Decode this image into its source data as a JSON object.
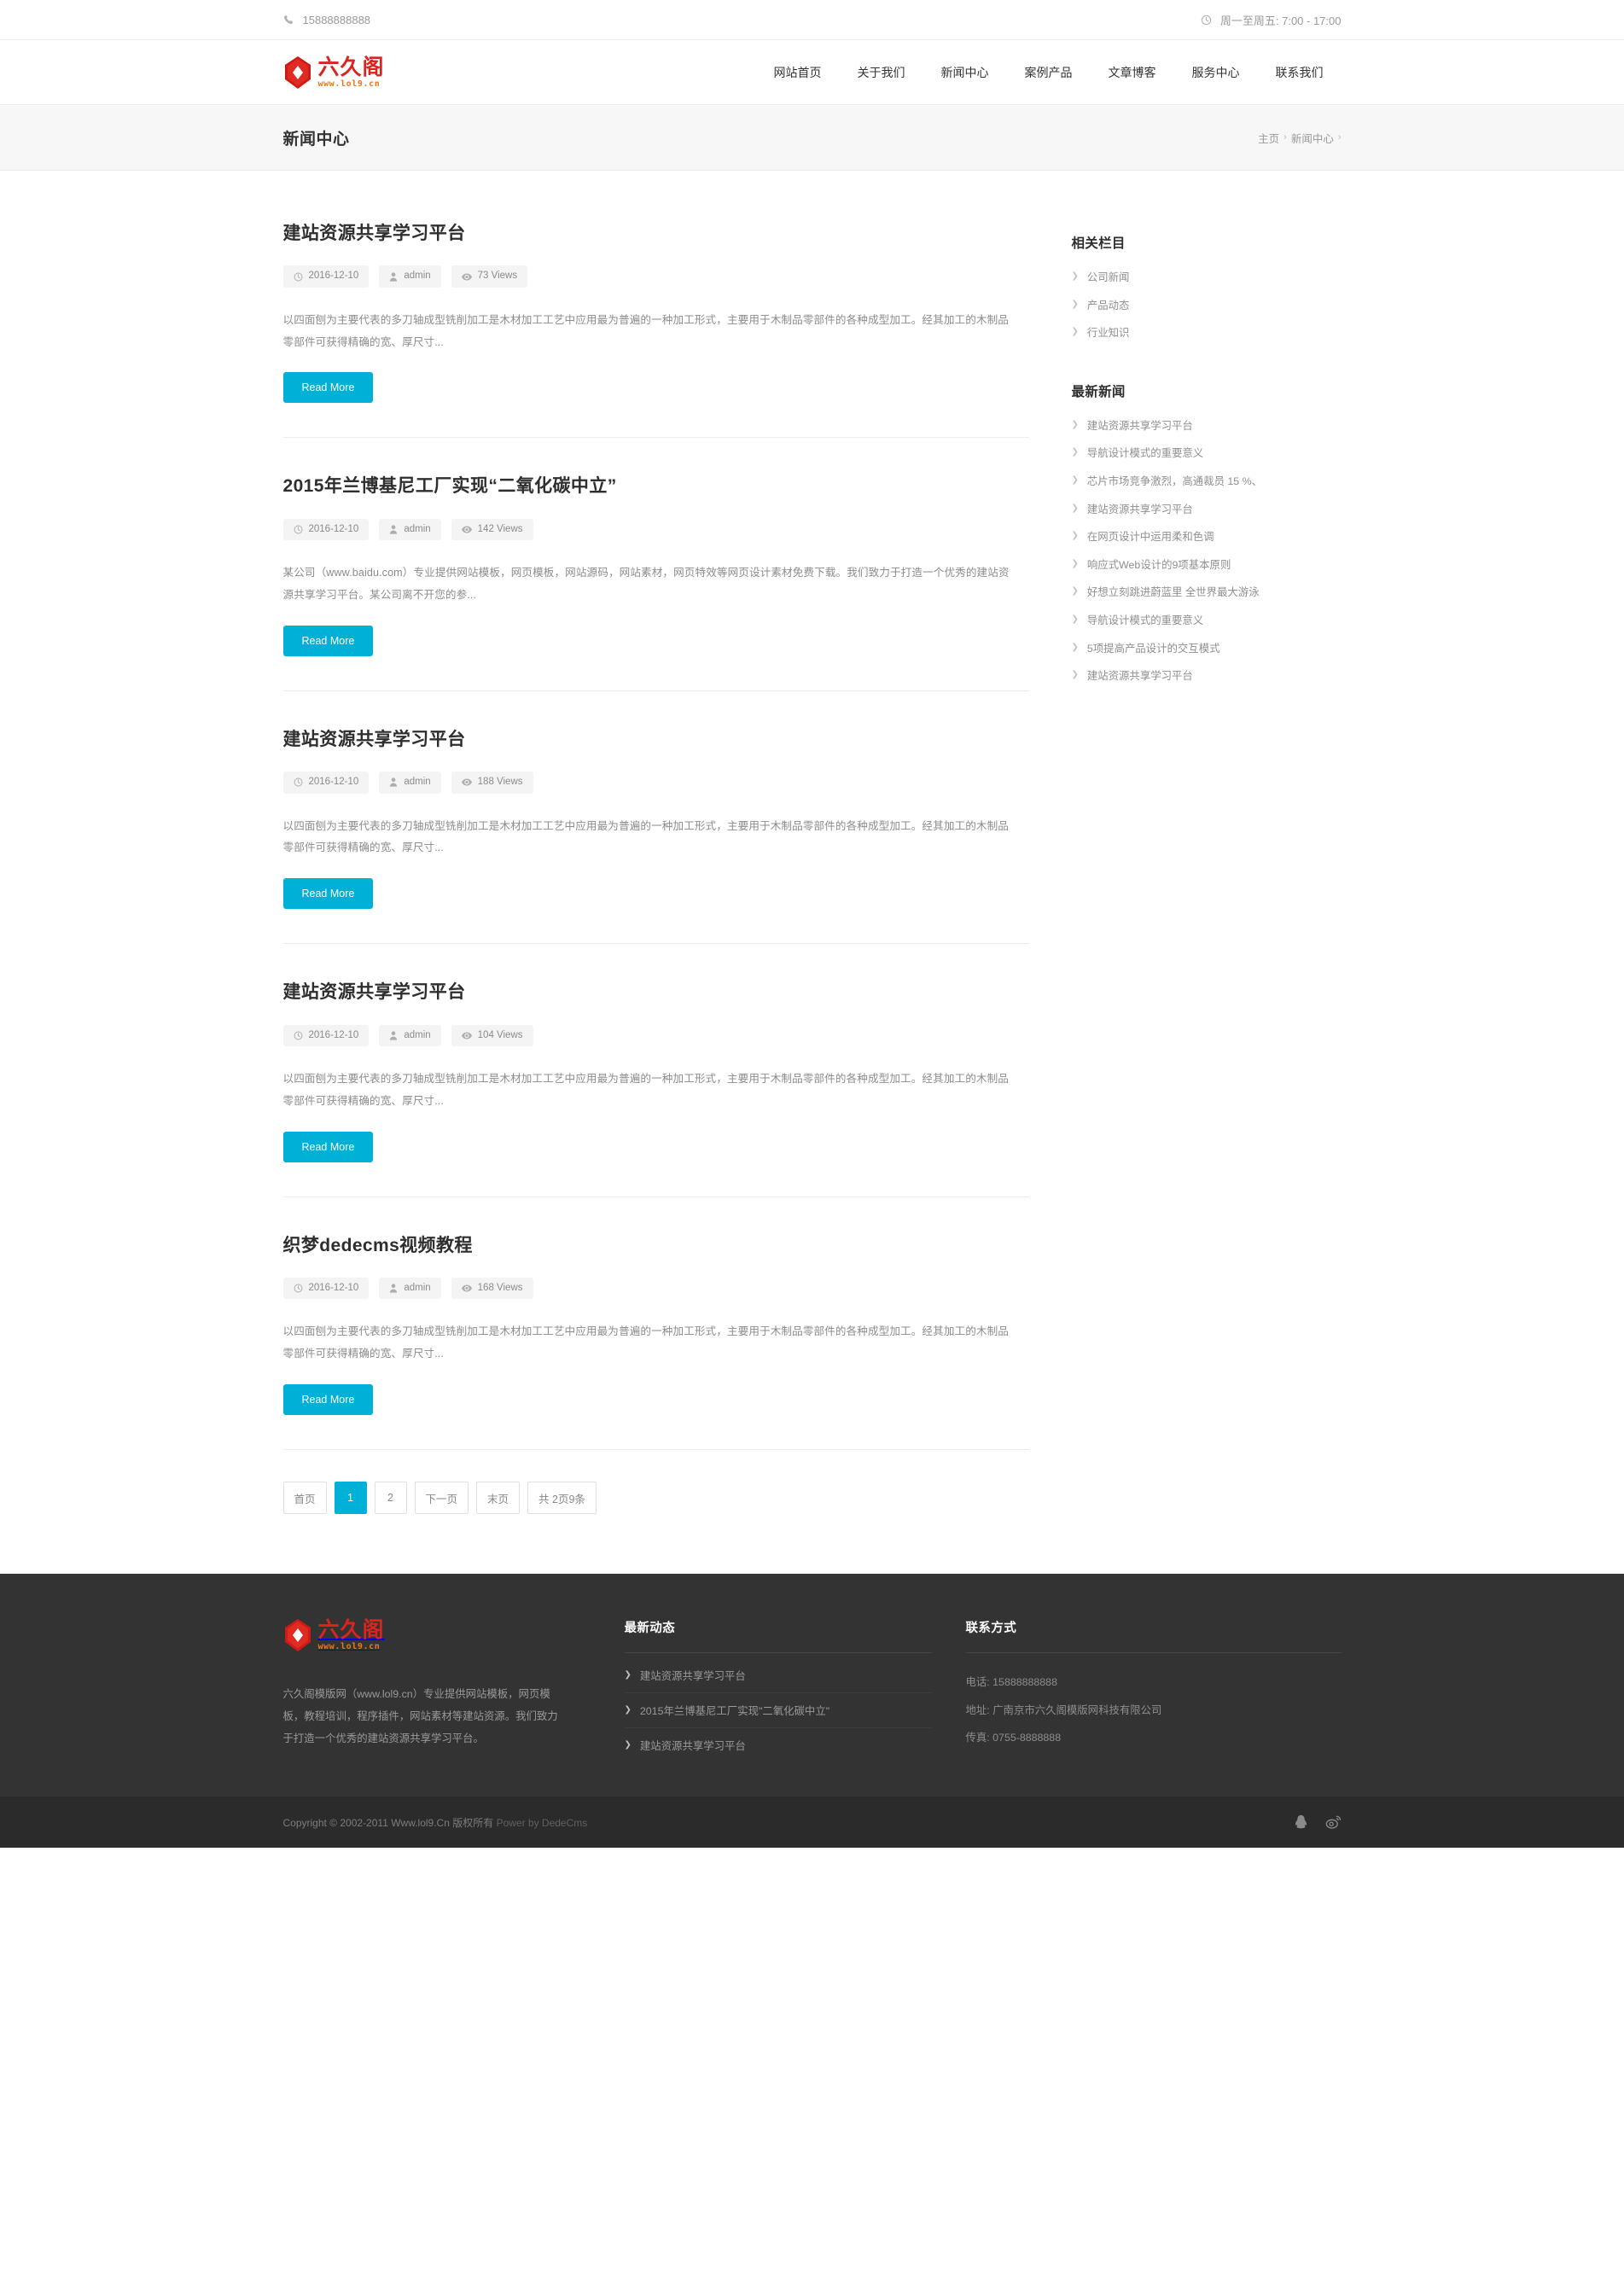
{
  "topbar": {
    "phone_icon": "phone-icon",
    "phone": "15888888888",
    "clock_icon": "clock-icon",
    "hours": "周一至周五: 7:00 - 17:00"
  },
  "header": {
    "logo_cn": "六久阁",
    "logo_url": "www.lol9.cn",
    "nav": [
      {
        "label": "网站首页"
      },
      {
        "label": "关于我们"
      },
      {
        "label": "新闻中心"
      },
      {
        "label": "案例产品"
      },
      {
        "label": "文章博客"
      },
      {
        "label": "服务中心"
      },
      {
        "label": "联系我们"
      }
    ]
  },
  "banner": {
    "title": "新闻中心",
    "crumb_home": "主页",
    "crumb_sep": "›",
    "crumb_current": "新闻中心",
    "crumb_tail": "›"
  },
  "articles": [
    {
      "title": "建站资源共享学习平台",
      "date": "2016-12-10",
      "author": "admin",
      "views": "73 Views",
      "excerpt": "以四面刨为主要代表的多刀轴成型铣削加工是木材加工工艺中应用最为普遍的一种加工形式，主要用于木制品零部件的各种成型加工。经其加工的木制品零部件可获得精确的宽、厚尺寸...",
      "readmore": "Read More"
    },
    {
      "title": "2015年兰博基尼工厂实现“二氧化碳中立”",
      "date": "2016-12-10",
      "author": "admin",
      "views": "142 Views",
      "excerpt": "某公司（www.baidu.com）专业提供网站模板，网页模板，网站源码，网站素材，网页特效等网页设计素材免费下载。我们致力于打造一个优秀的建站资源共享学习平台。某公司离不开您的参...",
      "readmore": "Read More"
    },
    {
      "title": "建站资源共享学习平台",
      "date": "2016-12-10",
      "author": "admin",
      "views": "188 Views",
      "excerpt": "以四面刨为主要代表的多刀轴成型铣削加工是木材加工工艺中应用最为普遍的一种加工形式，主要用于木制品零部件的各种成型加工。经其加工的木制品零部件可获得精确的宽、厚尺寸...",
      "readmore": "Read More"
    },
    {
      "title": "建站资源共享学习平台",
      "date": "2016-12-10",
      "author": "admin",
      "views": "104 Views",
      "excerpt": "以四面刨为主要代表的多刀轴成型铣削加工是木材加工工艺中应用最为普遍的一种加工形式，主要用于木制品零部件的各种成型加工。经其加工的木制品零部件可获得精确的宽、厚尺寸...",
      "readmore": "Read More"
    },
    {
      "title": "织梦dedecms视频教程",
      "date": "2016-12-10",
      "author": "admin",
      "views": "168 Views",
      "excerpt": "以四面刨为主要代表的多刀轴成型铣削加工是木材加工工艺中应用最为普遍的一种加工形式，主要用于木制品零部件的各种成型加工。经其加工的木制品零部件可获得精确的宽、厚尺寸...",
      "readmore": "Read More"
    }
  ],
  "pagination": {
    "items": [
      {
        "label": "首页",
        "active": false
      },
      {
        "label": "1",
        "active": true
      },
      {
        "label": "2",
        "active": false
      },
      {
        "label": "下一页",
        "active": false
      },
      {
        "label": "末页",
        "active": false
      },
      {
        "label": "共 2页9条",
        "active": false
      }
    ]
  },
  "sidebar": {
    "categories_title": "相关栏目",
    "categories": [
      {
        "label": "公司新闻"
      },
      {
        "label": "产品动态"
      },
      {
        "label": "行业知识"
      }
    ],
    "latest_title": "最新新闻",
    "latest": [
      {
        "label": "建站资源共享学习平台"
      },
      {
        "label": "导航设计模式的重要意义"
      },
      {
        "label": "芯片市场竞争激烈，高通裁员 15 %、"
      },
      {
        "label": "建站资源共享学习平台"
      },
      {
        "label": "在网页设计中运用柔和色调"
      },
      {
        "label": "响应式Web设计的9项基本原则"
      },
      {
        "label": "好想立刻跳进蔚蓝里 全世界最大游泳"
      },
      {
        "label": "导航设计模式的重要意义"
      },
      {
        "label": "5项提高产品设计的交互模式"
      },
      {
        "label": "建站资源共享学习平台"
      }
    ]
  },
  "footer": {
    "logo_cn": "六久阁",
    "logo_url": "www.lol9.cn",
    "about": "六久阁模版网（www.lol9.cn）专业提供网站模板，网页模板，教程培训，程序插件，网站素材等建站资源。我们致力于打造一个优秀的建站资源共享学习平台。",
    "news_title": "最新动态",
    "news": [
      {
        "label": "建站资源共享学习平台"
      },
      {
        "label": "2015年兰博基尼工厂实现\"二氧化碳中立\""
      },
      {
        "label": "建站资源共享学习平台"
      }
    ],
    "contact_title": "联系方式",
    "contact": [
      {
        "label": "电话: 15888888888"
      },
      {
        "label": "地址: 广南京市六久阁模版网科技有限公司"
      },
      {
        "label": "传真: 0755-8888888"
      }
    ],
    "copyright_main": "Copyright © 2002-2011 Www.lol9.Cn 版权所有",
    "copyright_dim": "Power by DedeCms",
    "social": [
      {
        "name": "qq-icon"
      },
      {
        "name": "weibo-icon"
      }
    ]
  },
  "colors": {
    "accent": "#00b0d7",
    "logo_red": "#d9241f",
    "logo_orange": "#e8781a",
    "footer_bg": "#333333",
    "copybar_bg": "#2b2b2b"
  }
}
